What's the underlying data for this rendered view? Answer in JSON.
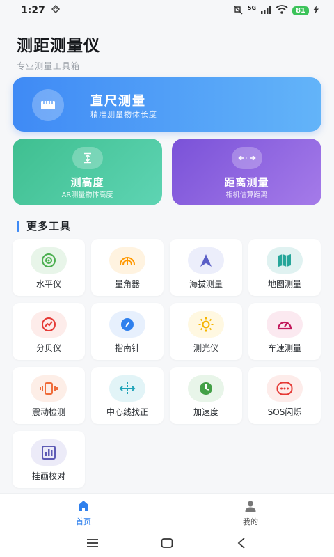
{
  "status_bar": {
    "time": "1:27",
    "battery": "81",
    "network": "5G"
  },
  "header": {
    "title": "测距测量仪",
    "subtitle": "专业测量工具箱"
  },
  "cards": {
    "ruler": {
      "name": "直尺测量",
      "desc": "精准测量物体长度",
      "icon": "ruler-icon"
    },
    "height": {
      "name": "测高度",
      "desc": "AR测量物体高度",
      "icon": "height-arrows-icon"
    },
    "distance": {
      "name": "距离测量",
      "desc": "相机估算距离",
      "icon": "distance-arrows-icon"
    }
  },
  "section": {
    "title": "更多工具"
  },
  "tools": [
    {
      "label": "水平仪",
      "icon": "level-icon",
      "color": "#4caf50",
      "bg": "#e8f5e9"
    },
    {
      "label": "量角器",
      "icon": "protractor-icon",
      "color": "#ff9800",
      "bg": "#fff3e0"
    },
    {
      "label": "海拔测量",
      "icon": "navigation-arrow-icon",
      "color": "#5b5fc7",
      "bg": "#eceefb"
    },
    {
      "label": "地图测量",
      "icon": "map-icon",
      "color": "#26a69a",
      "bg": "#e0f2f1"
    },
    {
      "label": "分贝仪",
      "icon": "decibel-gauge-icon",
      "color": "#e53935",
      "bg": "#fdecea"
    },
    {
      "label": "指南针",
      "icon": "compass-icon",
      "color": "#2f80ed",
      "bg": "#e7f0fd"
    },
    {
      "label": "测光仪",
      "icon": "sun-icon",
      "color": "#f5b400",
      "bg": "#fff8e1"
    },
    {
      "label": "车速测量",
      "icon": "speedometer-icon",
      "color": "#c2185b",
      "bg": "#fbe9f0"
    },
    {
      "label": "震动检测",
      "icon": "vibration-icon",
      "color": "#ef6c3a",
      "bg": "#fdeee7"
    },
    {
      "label": "中心线找正",
      "icon": "center-line-icon",
      "color": "#1fa3b8",
      "bg": "#e2f4f7"
    },
    {
      "label": "加速度",
      "icon": "acceleration-clock-icon",
      "color": "#43a047",
      "bg": "#e8f5e9"
    },
    {
      "label": "SOS闪烁",
      "icon": "sos-icon",
      "color": "#e53935",
      "bg": "#fdecea"
    },
    {
      "label": "挂画校对",
      "icon": "bar-chart-icon",
      "color": "#5e5bb5",
      "bg": "#ecebf8"
    }
  ],
  "tabbar": {
    "home": {
      "label": "首页",
      "color": "#2f80ed"
    },
    "mine": {
      "label": "我的",
      "color": "#666666"
    }
  }
}
